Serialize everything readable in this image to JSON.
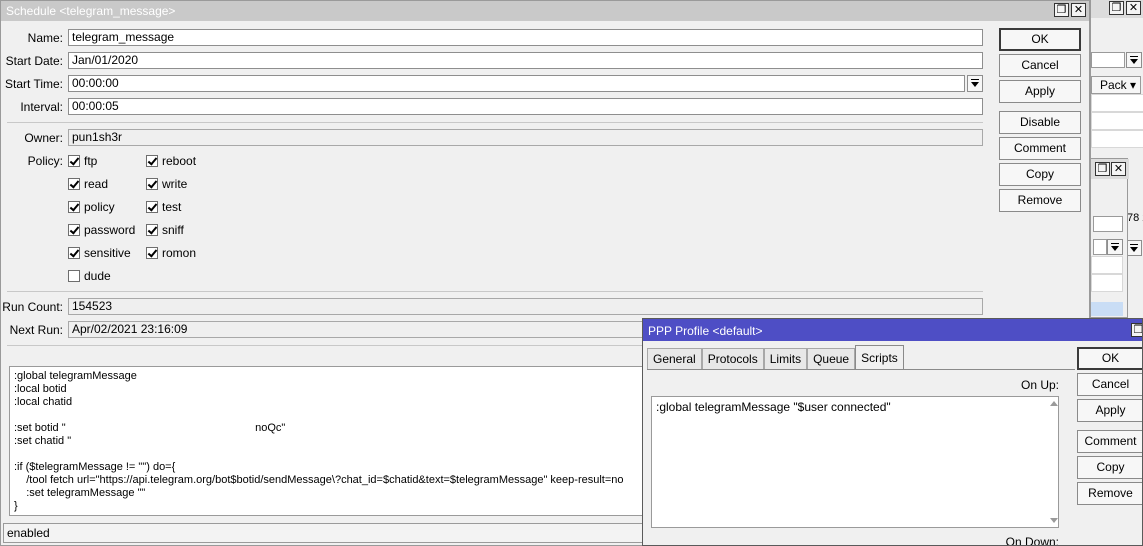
{
  "background_window": {
    "header_cell": "Pack",
    "clipped_text": "78 2"
  },
  "schedule": {
    "title": "Schedule <telegram_message>",
    "fields": {
      "name_label": "Name:",
      "name": "telegram_message",
      "start_date_label": "Start Date:",
      "start_date": "Jan/01/2020",
      "start_time_label": "Start Time:",
      "start_time": "00:00:00",
      "interval_label": "Interval:",
      "interval": "00:00:05",
      "owner_label": "Owner:",
      "owner": "pun1sh3r",
      "policy_label": "Policy:",
      "run_count_label": "Run Count:",
      "run_count": "154523",
      "next_run_label": "Next Run:",
      "next_run": "Apr/02/2021 23:16:09"
    },
    "policy": [
      {
        "label": "ftp",
        "checked": true
      },
      {
        "label": "reboot",
        "checked": true
      },
      {
        "label": "read",
        "checked": true
      },
      {
        "label": "write",
        "checked": true
      },
      {
        "label": "policy",
        "checked": true
      },
      {
        "label": "test",
        "checked": true
      },
      {
        "label": "password",
        "checked": true
      },
      {
        "label": "sniff",
        "checked": true
      },
      {
        "label": "sensitive",
        "checked": true
      },
      {
        "label": "romon",
        "checked": true
      },
      {
        "label": "dude",
        "checked": false
      }
    ],
    "buttons": [
      "OK",
      "Cancel",
      "Apply",
      "Disable",
      "Comment",
      "Copy",
      "Remove"
    ],
    "script_lines": [
      ":global telegramMessage",
      ":local botid",
      ":local chatid",
      "",
      ":set botid \"                                                              noQc\"",
      ":set chatid \"",
      "",
      ":if ($telegramMessage != \"\") do={",
      "    /tool fetch url=\"https://api.telegram.org/bot$botid/sendMessage\\?chat_id=$chatid&text=$telegramMessage\" keep-result=no",
      "    :set telegramMessage \"\"",
      "}"
    ],
    "status": "enabled"
  },
  "ppp": {
    "title": "PPP Profile <default>",
    "tabs": [
      {
        "label": "General",
        "active": false
      },
      {
        "label": "Protocols",
        "active": false
      },
      {
        "label": "Limits",
        "active": false
      },
      {
        "label": "Queue",
        "active": false
      },
      {
        "label": "Scripts",
        "active": true
      }
    ],
    "on_up_label": "On Up:",
    "on_up_script": ":global telegramMessage \"$user connected\"",
    "on_down_label": "On Down:",
    "buttons": [
      "OK",
      "Cancel",
      "Apply",
      "Comment",
      "Copy",
      "Remove"
    ]
  }
}
